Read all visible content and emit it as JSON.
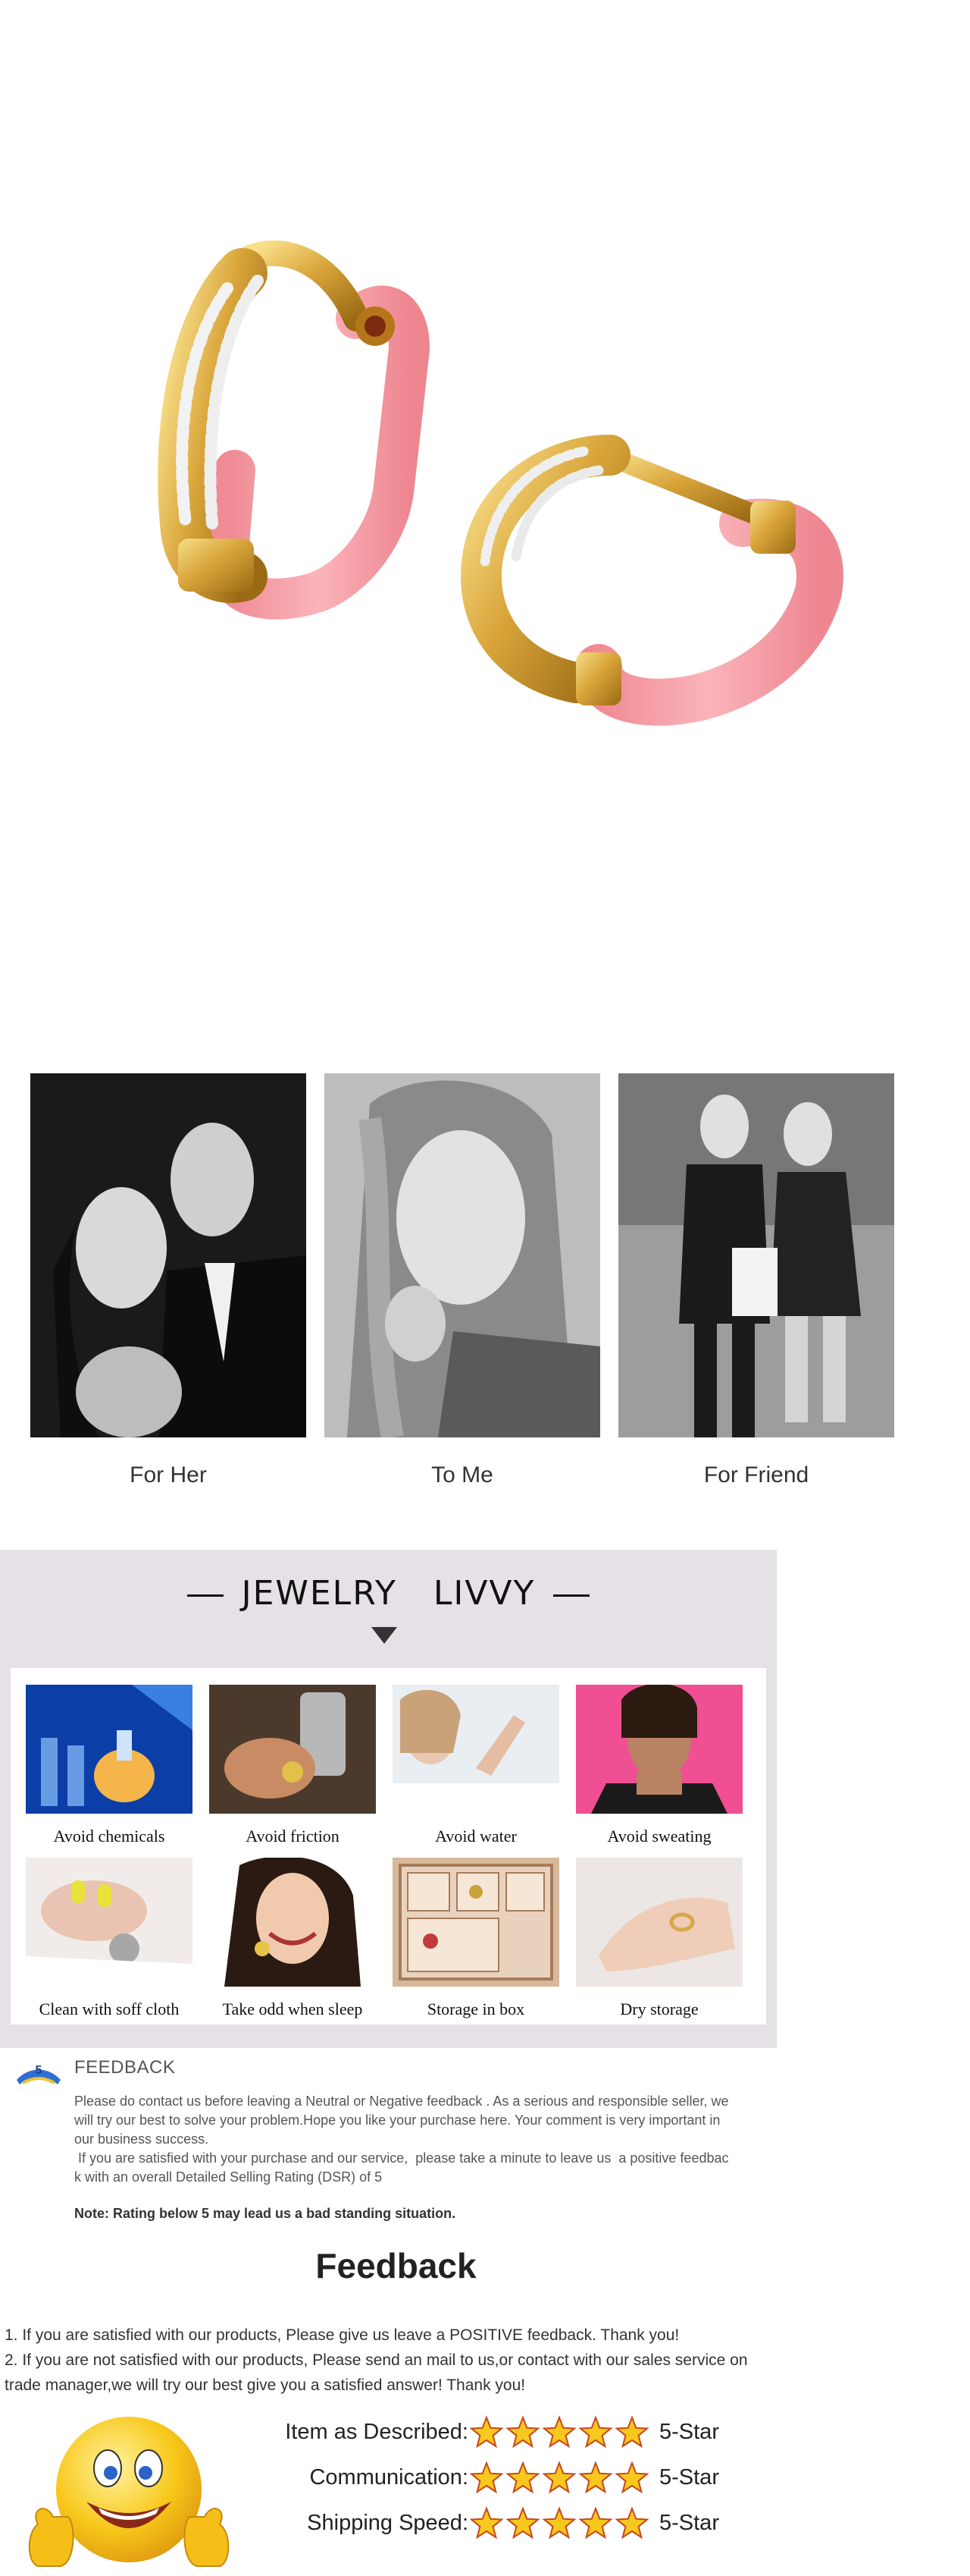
{
  "gifts": [
    {
      "caption": "For Her"
    },
    {
      "caption": "To Me"
    },
    {
      "caption": "For Friend"
    }
  ],
  "care": {
    "title_left": "JEWELRY",
    "title_right": "LIVVY",
    "items": [
      {
        "label": "Avoid chemicals"
      },
      {
        "label": "Avoid friction"
      },
      {
        "label": "Avoid water"
      },
      {
        "label": "Avoid sweating"
      },
      {
        "label": "Clean with soff cloth"
      },
      {
        "label": "Take odd when sleep"
      },
      {
        "label": "Storage in box"
      },
      {
        "label": "Dry storage"
      }
    ]
  },
  "feedback_note": {
    "heading": "FEEDBACK",
    "logo_text": "5",
    "lines": [
      "Please do contact us before leaving a Neutral or Negative  feedback . As a serious and responsible seller, we",
      "will try our best to solve your problem.Hope you like your purchase here. Your comment is very important in",
      "our business success.",
      " If you are satisfied with your purchase and our service,  please take a minute to leave us  a positive feedbac",
      "k with an overall  Detailed Selling Rating (DSR) of 5"
    ],
    "warning": "Note: Rating below 5 may lead us a bad standing situation."
  },
  "feedback": {
    "title": "Feedback",
    "line1": "1. If you are satisfied with our products, Please give us leave a POSITIVE feedback. Thank you!",
    "line2a": "2. If you are not satisfied with our products, Please send an mail to us,or contact with our sales service on",
    "line2b": "trade manager,we will try our best give you a satisfied answer! Thank you!",
    "ratings": [
      {
        "label": "Item as Described:",
        "stars": 5,
        "value": "5-Star"
      },
      {
        "label": "Communication:",
        "stars": 5,
        "value": "5-Star"
      },
      {
        "label": "Shipping Speed:",
        "stars": 5,
        "value": "5-Star"
      }
    ]
  },
  "colors": {
    "enamel_pink": "#f7a1a8",
    "gold": "#d9a53a",
    "panel_bg": "#e5e1e7",
    "star_yellow": "#f7c81e"
  }
}
